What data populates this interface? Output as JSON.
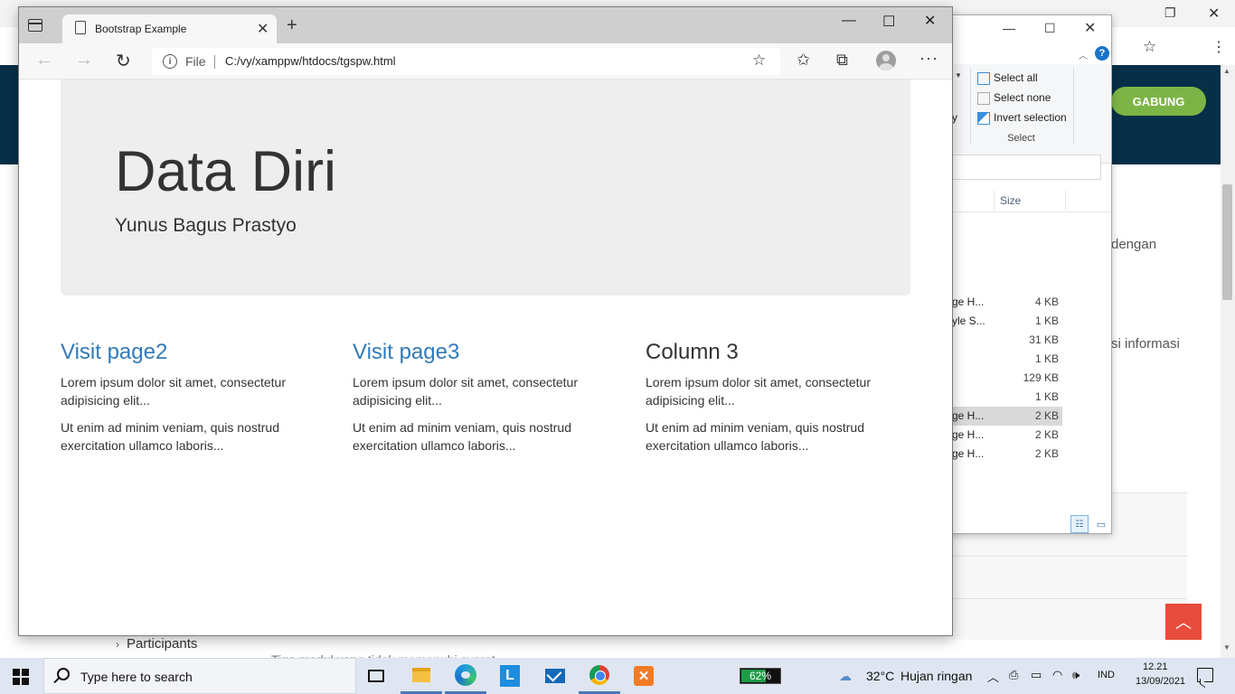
{
  "background_browser": {
    "join_button": "GABUNG",
    "text_fragments": [
      "dengan",
      "si informasi"
    ],
    "sidebar_item": "Participants",
    "lower_text": "Tiga modul yang tidak memenuhi syarat"
  },
  "file_explorer": {
    "ribbon": {
      "select_all": "Select all",
      "select_none": "Select none",
      "invert_selection": "Invert selection",
      "group_label": "Select",
      "fragment_left": "y"
    },
    "column_size_label": "Size",
    "rows": [
      {
        "name": "ge H...",
        "size": "4 KB",
        "selected": false
      },
      {
        "name": "yle S...",
        "size": "1 KB",
        "selected": false
      },
      {
        "name": "",
        "size": "31 KB",
        "selected": false
      },
      {
        "name": "",
        "size": "1 KB",
        "selected": false
      },
      {
        "name": "",
        "size": "129 KB",
        "selected": false
      },
      {
        "name": "",
        "size": "1 KB",
        "selected": false
      },
      {
        "name": "ge H...",
        "size": "2 KB",
        "selected": true
      },
      {
        "name": "ge H...",
        "size": "2 KB",
        "selected": false
      },
      {
        "name": "ge H...",
        "size": "2 KB",
        "selected": false
      }
    ]
  },
  "browser": {
    "tab_title": "Bootstrap Example",
    "address": {
      "scheme_label": "File",
      "url": "C:/vy/xamppw/htdocs/tgspw.html"
    }
  },
  "page": {
    "jumbotron": {
      "title": "Data Diri",
      "subtitle": "Yunus Bagus Prastyo"
    },
    "columns": [
      {
        "heading": "Visit page2",
        "is_link": true,
        "p1": "Lorem ipsum dolor sit amet, consectetur adipisicing elit...",
        "p2": "Ut enim ad minim veniam, quis nostrud exercitation ullamco laboris..."
      },
      {
        "heading": "Visit page3",
        "is_link": true,
        "p1": "Lorem ipsum dolor sit amet, consectetur adipisicing elit...",
        "p2": "Ut enim ad minim veniam, quis nostrud exercitation ullamco laboris..."
      },
      {
        "heading": "Column 3",
        "is_link": false,
        "p1": "Lorem ipsum dolor sit amet, consectetur adipisicing elit...",
        "p2": "Ut enim ad minim veniam, quis nostrud exercitation ullamco laboris..."
      }
    ]
  },
  "taskbar": {
    "search_placeholder": "Type here to search",
    "battery": "62%",
    "weather_temp": "32°C",
    "weather_desc": "Hujan ringan",
    "language": "IND",
    "time": "12.21",
    "date": "13/09/2021"
  },
  "colors": {
    "link": "#337ab7",
    "jumbotron_bg": "#eeeeee",
    "site_header": "#073048",
    "join_button": "#7db446",
    "scroll_top_button": "#e74c3c"
  }
}
